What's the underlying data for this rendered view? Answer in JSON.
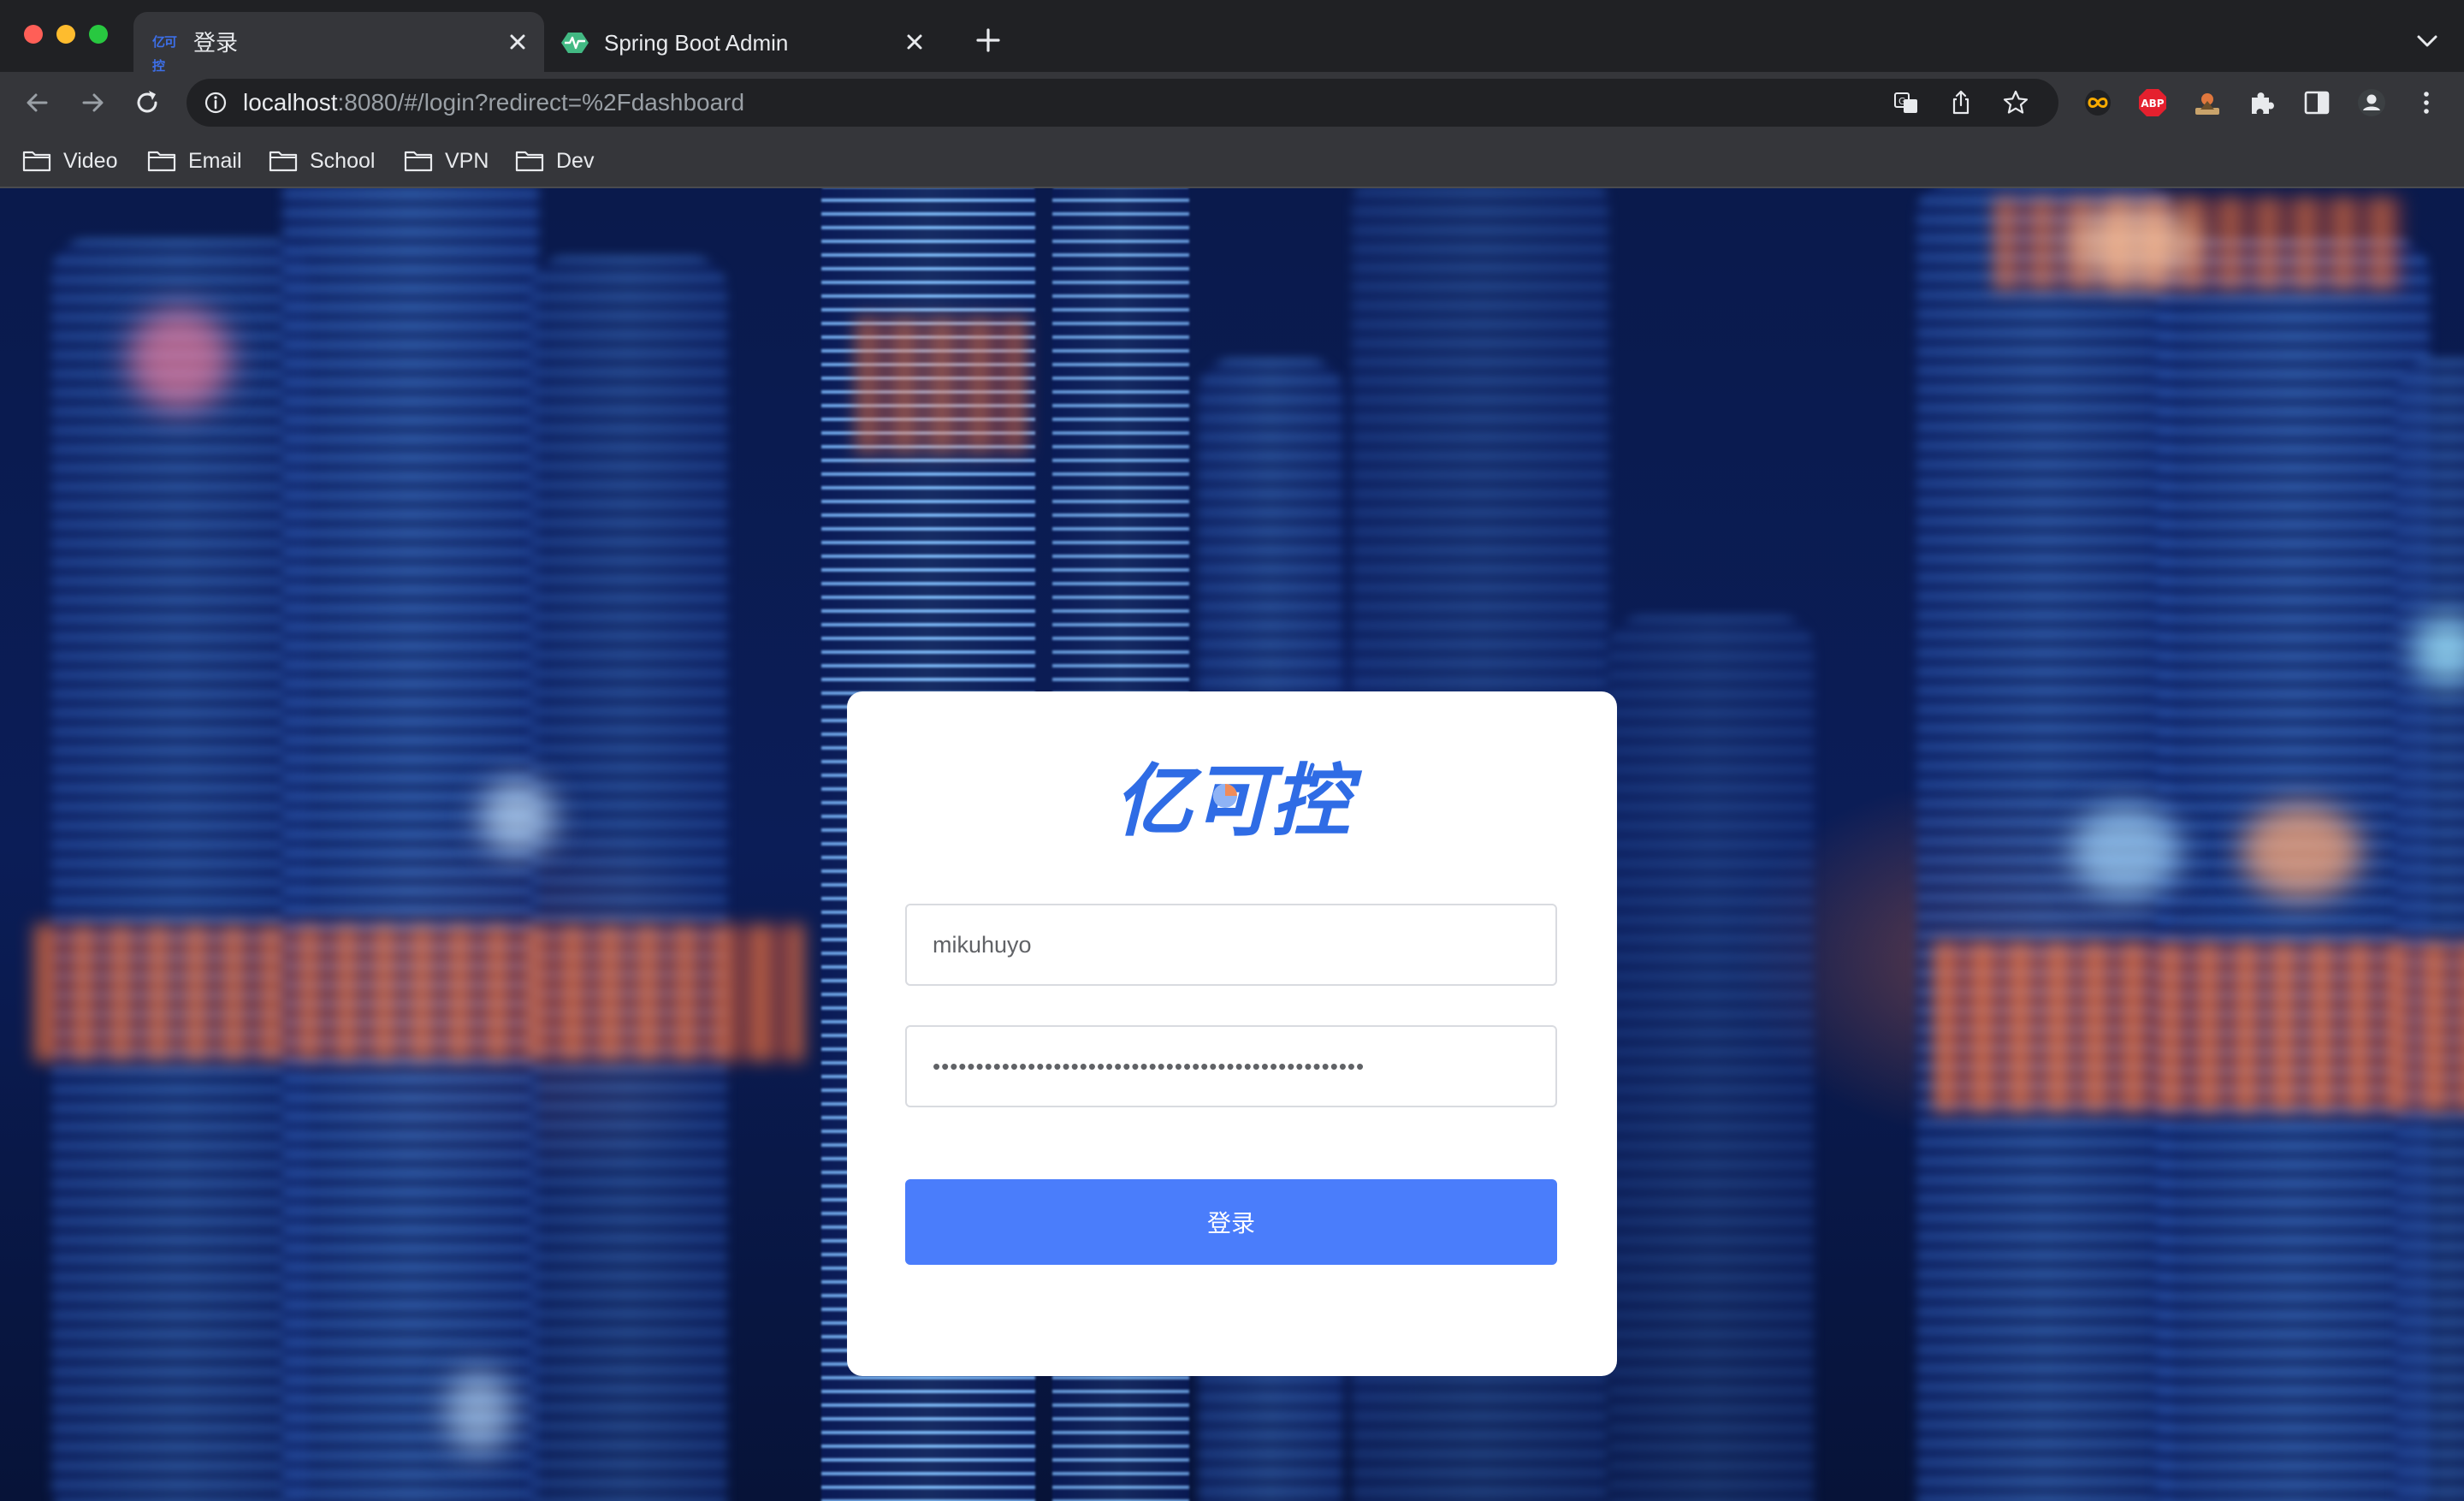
{
  "browser": {
    "tabs": [
      {
        "title": "登录",
        "active": true,
        "favicon": "yikekong-logo-mini"
      },
      {
        "title": "Spring Boot Admin",
        "active": false,
        "favicon": "spring-boot-admin-icon"
      }
    ],
    "url": {
      "host": "localhost",
      "rest": ":8080/#/login?redirect=%2Fdashboard"
    },
    "bookmarks": [
      {
        "label": "Video"
      },
      {
        "label": "Email"
      },
      {
        "label": "School"
      },
      {
        "label": "VPN"
      },
      {
        "label": "Dev"
      }
    ],
    "extensions": [
      "infinity-icon",
      "adblock-plus-icon",
      "profile-extension-icon",
      "puzzle-extensions-icon",
      "side-panel-icon",
      "account-icon",
      "more-menu-icon"
    ]
  },
  "login": {
    "logo_text": "亿可控",
    "username_value": "mikuhuyo",
    "password_value": "••••••••••••••••••••••••••••••••••••••••••••••••••",
    "submit_label": "登录",
    "accent_color": "#4a7dfb"
  }
}
